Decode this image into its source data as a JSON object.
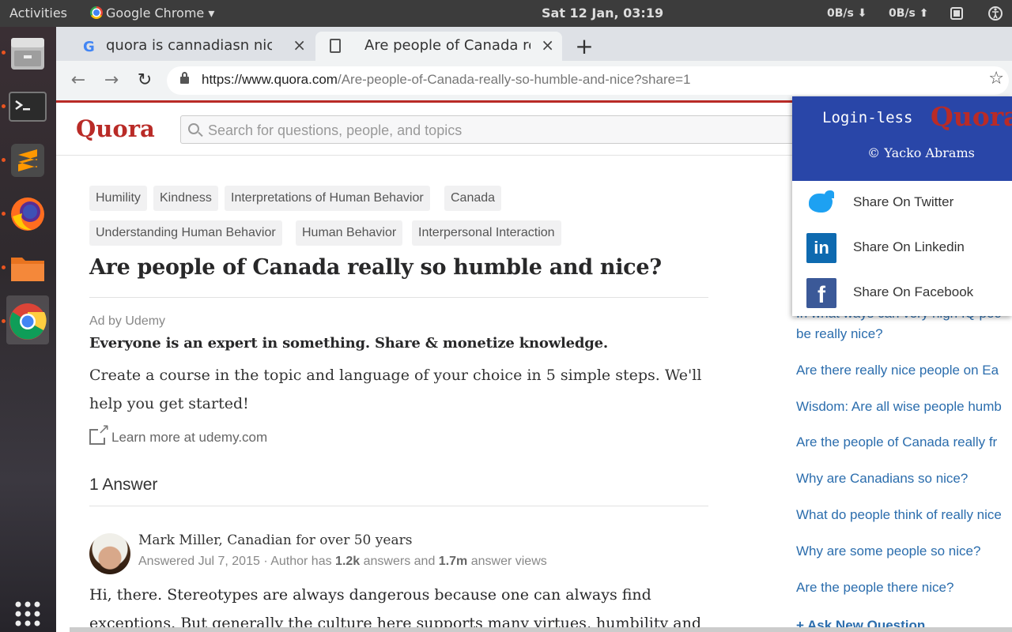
{
  "system": {
    "activities": "Activities",
    "app_menu": "Google Chrome ▾",
    "clock": "Sat 12 Jan, 03:19",
    "net_down": "0B/s ⬇",
    "net_up": "0B/s ⬆"
  },
  "dock": {
    "items": [
      "Files",
      "Terminal",
      "Sublime Text",
      "Firefox",
      "File Manager",
      "Google Chrome"
    ],
    "app_grid_icon": "show-apps-icon"
  },
  "tabs": [
    {
      "title": "quora is cannadiasn nice -",
      "close": "×"
    },
    {
      "title": "Are people of Canada rea",
      "close": "×"
    }
  ],
  "new_tab": "+",
  "toolbar": {
    "back": "←",
    "forward": "→",
    "reload": "↻",
    "star": "☆"
  },
  "url": {
    "prefix": "https://www.quora.com",
    "path": "/Are-people-of-Canada-really-so-humble-and-nice?share=1"
  },
  "quora": {
    "logo": "Quora",
    "search_placeholder": "Search for questions, people, and topics",
    "topics_row1": [
      "Humility",
      "Kindness",
      "Interpretations of Human Behavior",
      "Canada"
    ],
    "topics_row2": [
      "Understanding Human Behavior",
      "Human Behavior",
      "Interpersonal Interaction"
    ],
    "question": "Are people of Canada really so humble and nice?",
    "ad": {
      "label": "Ad by Udemy",
      "title": "Everyone is an expert in something. Share & monetize knowledge.",
      "body": "Create a course in the topic and language of your choice in 5 simple steps. We'll help you get started!",
      "link": "Learn more at udemy.com"
    },
    "answer_count": "1 Answer",
    "answer": {
      "author": "Mark Miller, Canadian for over 50 years",
      "meta_prefix": "Answered Jul 7, 2015 · Author has ",
      "answers_count": "1.2k",
      "meta_mid": " answers and ",
      "views_count": "1.7m",
      "meta_suffix": " answer views",
      "text": "Hi, there. Stereotypes are always dangerous because one can always find exceptions. But generally the culture here supports many virtues, humbility and"
    },
    "related": [
      "In what ways can very high IQ peo",
      "be really nice?",
      "Are there really nice people on Ea",
      "Wisdom: Are all wise people humb",
      "Are the people of Canada really fr",
      "Why are Canadians so nice?",
      "What do people think of really nice",
      "Why are some people so nice?",
      "Are the people there nice?"
    ],
    "ask_new": "+ Ask New Question"
  },
  "popup": {
    "title": "Login-less",
    "brand": "Quora",
    "credit": "© Yacko Abrams",
    "share": [
      "Share On Twitter",
      "Share On Linkedin",
      "Share On Facebook"
    ],
    "linkedin_glyph": "in",
    "facebook_glyph": "f"
  }
}
